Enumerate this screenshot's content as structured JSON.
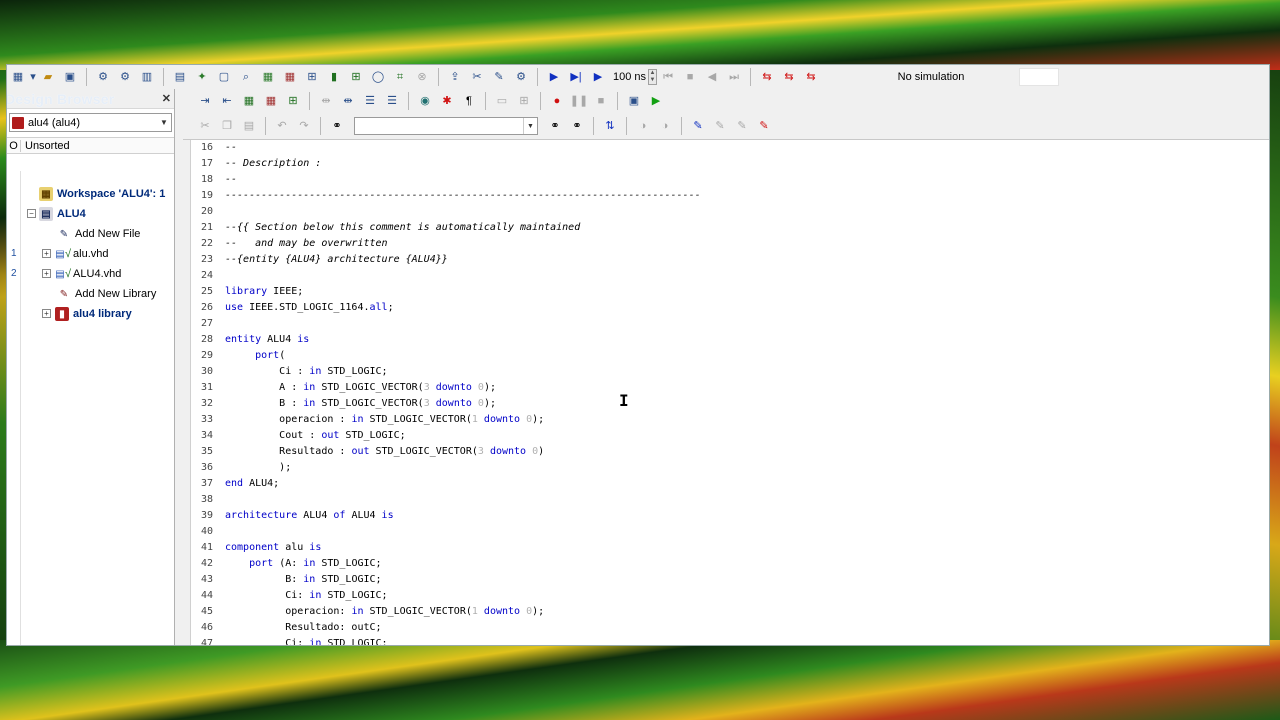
{
  "toolbar": {
    "sim_time": "100 ns",
    "sim_status": "No simulation",
    "search_value": ""
  },
  "design_browser": {
    "title": "Design Browser",
    "selected_library": "alu4 (alu4)",
    "column_o": "O",
    "column_label": "Unsorted",
    "items": [
      {
        "label": "Workspace 'ALU4': 1",
        "icon": "workspace-icon"
      },
      {
        "label": "ALU4",
        "icon": "design-icon"
      },
      {
        "label": "Add New File",
        "icon": "add-file-icon"
      },
      {
        "label": "alu.vhd",
        "icon": "vhdl-file-icon",
        "row": "1"
      },
      {
        "label": "ALU4.vhd",
        "icon": "vhdl-file-icon",
        "row": "2"
      },
      {
        "label": "Add New Library",
        "icon": "add-library-icon"
      },
      {
        "label": "alu4 library",
        "icon": "library-icon"
      }
    ]
  },
  "editor": {
    "lines": [
      {
        "n": "16",
        "t": "--"
      },
      {
        "n": "17",
        "t": "-- Description :"
      },
      {
        "n": "18",
        "t": "--"
      },
      {
        "n": "19",
        "t": "-------------------------------------------------------------------------------"
      },
      {
        "n": "20",
        "t": ""
      },
      {
        "n": "21",
        "t": "--{{ Section below this comment is automatically maintained"
      },
      {
        "n": "22",
        "t": "--   and may be overwritten"
      },
      {
        "n": "23",
        "t": "--{entity {ALU4} architecture {ALU4}}"
      },
      {
        "n": "24",
        "t": ""
      },
      {
        "n": "25",
        "t": "library IEEE;"
      },
      {
        "n": "26",
        "t": "use IEEE.STD_LOGIC_1164.all;"
      },
      {
        "n": "27",
        "t": ""
      },
      {
        "n": "28",
        "t": "entity ALU4 is"
      },
      {
        "n": "29",
        "t": "     port("
      },
      {
        "n": "30",
        "t": "         Ci : in STD_LOGIC;"
      },
      {
        "n": "31",
        "t": "         A : in STD_LOGIC_VECTOR(3 downto 0);"
      },
      {
        "n": "32",
        "t": "         B : in STD_LOGIC_VECTOR(3 downto 0);"
      },
      {
        "n": "33",
        "t": "         operacion : in STD_LOGIC_VECTOR(1 downto 0);"
      },
      {
        "n": "34",
        "t": "         Cout : out STD_LOGIC;"
      },
      {
        "n": "35",
        "t": "         Resultado : out STD_LOGIC_VECTOR(3 downto 0)"
      },
      {
        "n": "36",
        "t": "         );"
      },
      {
        "n": "37",
        "t": "end ALU4;"
      },
      {
        "n": "38",
        "t": ""
      },
      {
        "n": "39",
        "t": "architecture ALU4 of ALU4 is"
      },
      {
        "n": "40",
        "t": ""
      },
      {
        "n": "41",
        "t": "component alu is"
      },
      {
        "n": "42",
        "t": "    port (A: in STD_LOGIC;"
      },
      {
        "n": "43",
        "t": "          B: in STD_LOGIC;"
      },
      {
        "n": "44",
        "t": "          Ci: in STD_LOGIC;"
      },
      {
        "n": "45",
        "t": "          operacion: in STD_LOGIC_VECTOR(1 downto 0);"
      },
      {
        "n": "46",
        "t": "          Resultado: outC;"
      },
      {
        "n": "47",
        "t": "          Ci: in STD_LOGIC;"
      }
    ]
  }
}
